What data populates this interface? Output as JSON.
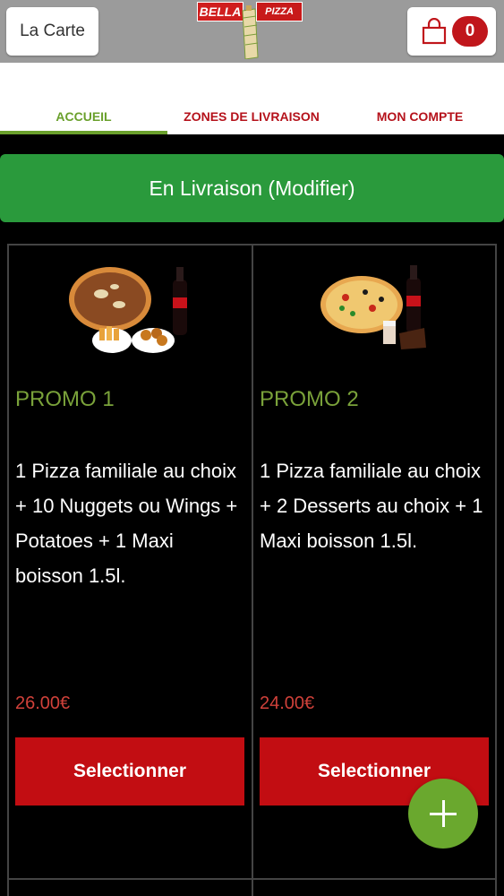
{
  "header": {
    "menu_label": "La Carte",
    "logo_text_left": "BELLA",
    "logo_text_right": "PIZZA",
    "cart_count": "0",
    "colors": {
      "header_bg": "#9b9b9b",
      "badge": "#c0161b"
    }
  },
  "tabs": [
    {
      "label": "ACCUEIL",
      "active": true
    },
    {
      "label": "ZONES DE LIVRAISON",
      "active": false
    },
    {
      "label": "MON COMPTE",
      "active": false
    }
  ],
  "delivery": {
    "label": "En Livraison (Modifier)",
    "color": "#2a9a3c"
  },
  "products": [
    {
      "title": "PROMO 1",
      "description": "1 Pizza familiale au choix  + 10 Nuggets ou Wings  + Potatoes  + 1 Maxi boisson 1.5l.",
      "price": "26.00€",
      "button": "Selectionner",
      "image": "pizza-nuggets-potatoes-cola"
    },
    {
      "title": "PROMO 2",
      "description": "1 Pizza familiale au choix  + 2 Desserts au choix  + 1 Maxi boisson 1.5l.",
      "price": "24.00€",
      "button": "Selectionner",
      "image": "pizza-desserts-cola"
    }
  ],
  "fab": {
    "icon": "plus-icon",
    "color": "#6aa82e"
  },
  "colors": {
    "accent_green": "#6aa02c",
    "tab_red": "#b5121b",
    "button_red": "#c20d12",
    "price_red": "#d0413a"
  }
}
